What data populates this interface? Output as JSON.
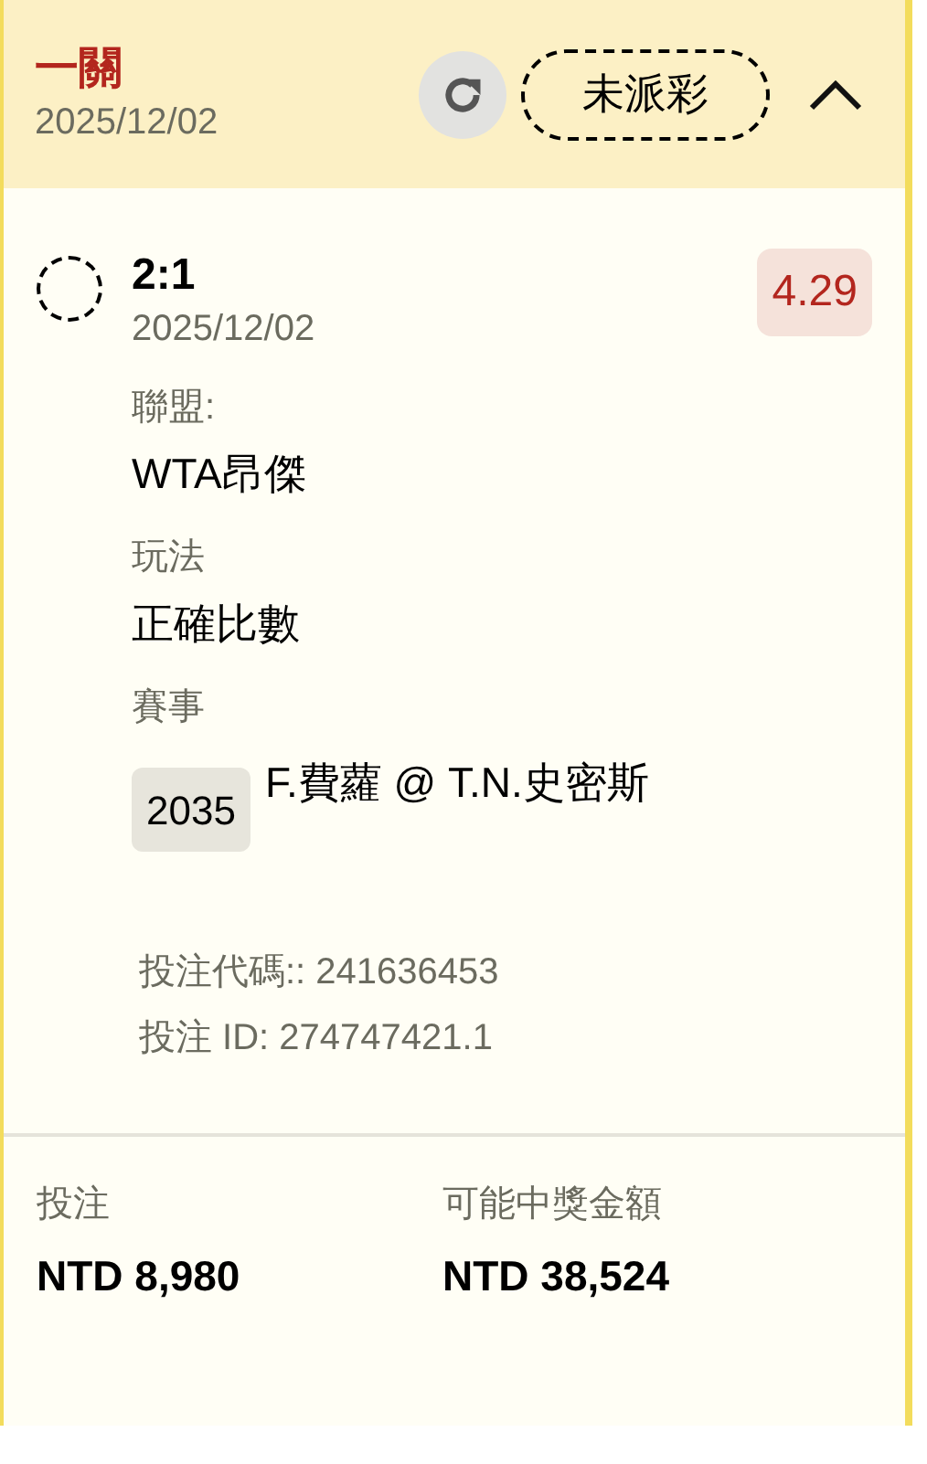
{
  "header": {
    "title": "一關",
    "date": "2025/12/02",
    "status": "未派彩",
    "expanded": true
  },
  "selection": {
    "name": "2:1",
    "date": "2025/12/02",
    "odds": "4.29",
    "checked": false
  },
  "details": [
    {
      "label": "聯盟:",
      "value": "WTA昂傑"
    },
    {
      "label": "玩法",
      "value": "正確比數"
    }
  ],
  "event": {
    "label": "賽事",
    "code": "2035",
    "name": "F.費蘿 @ T.N.史密斯"
  },
  "bet_code": "投注代碼:: 241636453",
  "bet_id": "投注 ID: 274747421.1",
  "summary": [
    {
      "label": "投注",
      "amount": "NTD 8,980"
    },
    {
      "label": "可能中獎金額",
      "amount": "NTD 38,524"
    }
  ]
}
